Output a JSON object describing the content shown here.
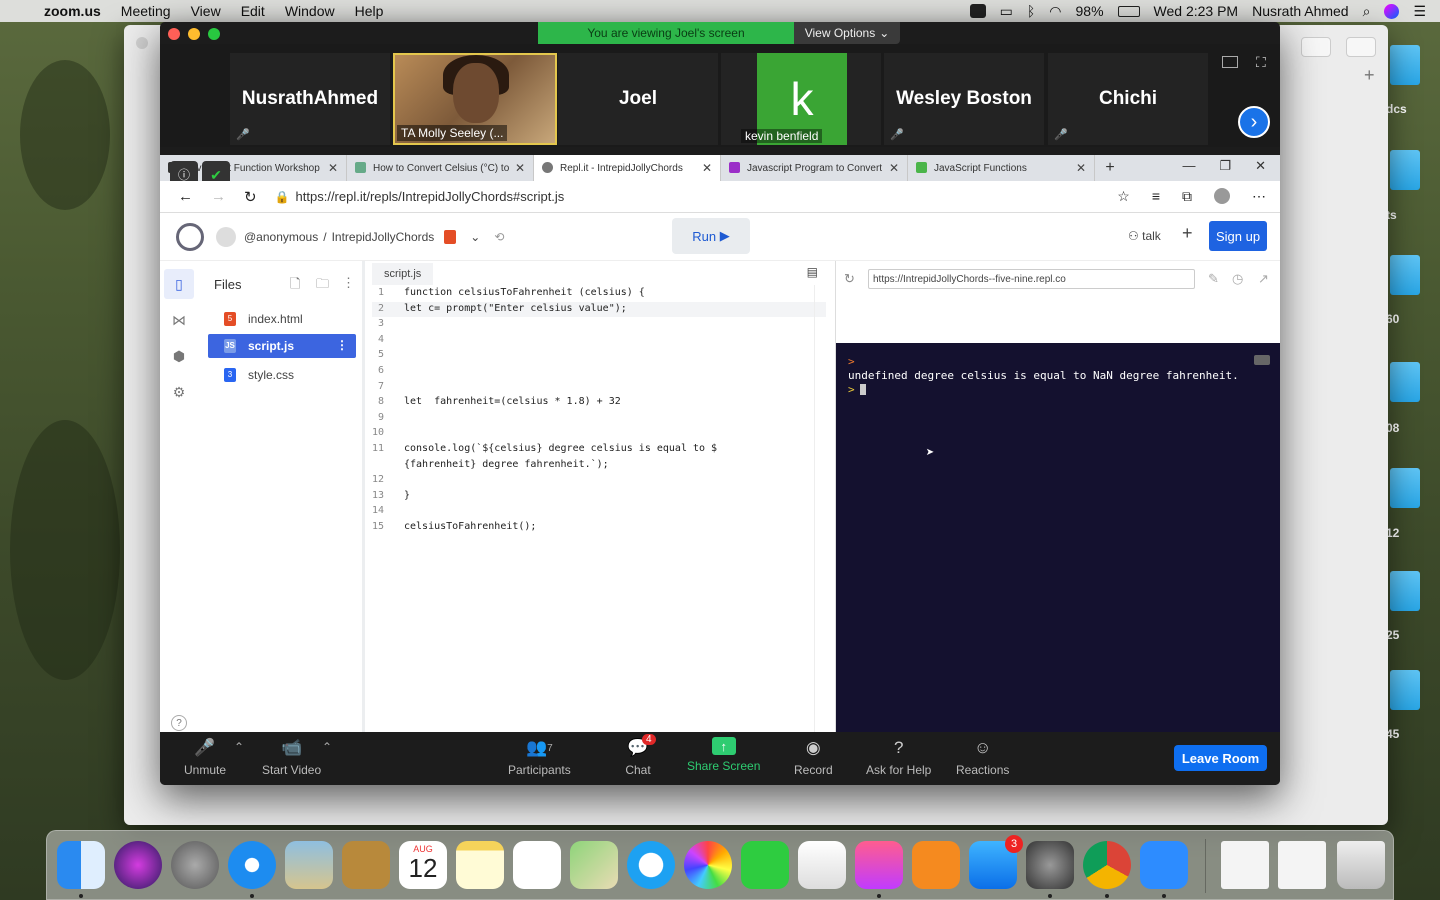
{
  "menubar": {
    "app": "zoom.us",
    "items": [
      "Meeting",
      "View",
      "Edit",
      "Window",
      "Help"
    ],
    "battery": "98%",
    "clock": "Wed 2:23 PM",
    "user": "Nusrath Ahmed"
  },
  "desktop_labels": [
    "dcs",
    "ts",
    "60",
    "08",
    "12",
    "25",
    "45"
  ],
  "zoom": {
    "banner": "You are viewing Joel's screen",
    "view_options": "View Options",
    "participants": [
      {
        "name": "NusrathAhmed"
      },
      {
        "name": "TA Molly Seeley (..."
      },
      {
        "name": "Joel"
      },
      {
        "name": "kevin benfield",
        "initial": "k"
      },
      {
        "name": "Wesley Boston"
      },
      {
        "name": "Chichi"
      }
    ],
    "toolbar": {
      "unmute": "Unmute",
      "start_video": "Start Video",
      "participants": "Participants",
      "participants_count": "7",
      "chat": "Chat",
      "chat_badge": "4",
      "share_screen": "Share Screen",
      "record": "Record",
      "ask_for_help": "Ask for Help",
      "reactions": "Reactions",
      "leave": "Leave Room"
    }
  },
  "browser": {
    "tabs": [
      {
        "label": "Javascript Function Workshop"
      },
      {
        "label": "How to Convert Celsius (°C) to"
      },
      {
        "label": "Repl.it - IntrepidJollyChords"
      },
      {
        "label": "Javascript Program to Convert"
      },
      {
        "label": "JavaScript Functions"
      }
    ],
    "url": "https://repl.it/repls/IntrepidJollyChords#script.js"
  },
  "repl": {
    "owner": "@anonymous",
    "separator": "/",
    "name": "IntrepidJollyChords",
    "run": "Run",
    "talk": "talk",
    "signup": "Sign up",
    "files_title": "Files",
    "files": [
      "index.html",
      "script.js",
      "style.css"
    ],
    "editor_tab": "script.js",
    "code": [
      {
        "n": "1",
        "text": "function celsiusToFahrenheit (celsius) {"
      },
      {
        "n": "2",
        "text": "let c= prompt(\"Enter celsius value\");"
      },
      {
        "n": "3",
        "text": ""
      },
      {
        "n": "4",
        "text": ""
      },
      {
        "n": "5",
        "text": ""
      },
      {
        "n": "6",
        "text": ""
      },
      {
        "n": "7",
        "text": ""
      },
      {
        "n": "8",
        "text": "let  fahrenheit=(celsius * 1.8) + 32"
      },
      {
        "n": "9",
        "text": ""
      },
      {
        "n": "10",
        "text": ""
      },
      {
        "n": "11",
        "text": "console.log(`${celsius} degree celsius is equal to $"
      },
      {
        "n": "",
        "text": "{fahrenheit} degree fahrenheit.`);"
      },
      {
        "n": "12",
        "text": ""
      },
      {
        "n": "13",
        "text": "}"
      },
      {
        "n": "14",
        "text": ""
      },
      {
        "n": "15",
        "text": "celsiusToFahrenheit();"
      }
    ],
    "preview_url": "https://IntrepidJollyChords--five-nine.repl.co",
    "console_prompt": ">",
    "console_output": "undefined degree celsius is equal to NaN degree fahrenheit.",
    "help": "?"
  },
  "dock": {
    "calendar_month": "AUG",
    "calendar_day": "12",
    "appstore_badge": "3"
  }
}
